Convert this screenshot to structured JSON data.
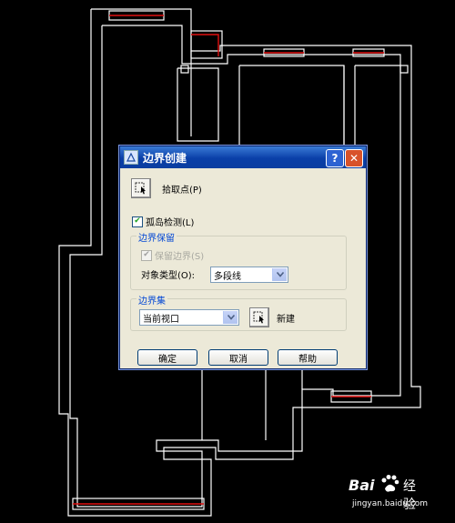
{
  "dialog": {
    "title": "边界创建",
    "help_button": "?",
    "close_button": "✕",
    "pick_points_label": "拾取点(P)",
    "island_detection_label": "孤岛检测(L)",
    "island_detection_checked": true,
    "boundary_retention": {
      "group_label": "边界保留",
      "retain_boundaries_label": "保留边界(S)",
      "retain_boundaries_checked": true,
      "retain_boundaries_enabled": false,
      "object_type_label": "对象类型(O):",
      "object_type_value": "多段线"
    },
    "boundary_set": {
      "group_label": "边界集",
      "set_value": "当前视口",
      "new_label": "新建"
    },
    "buttons": {
      "ok": "确定",
      "cancel": "取消",
      "help": "帮助"
    }
  },
  "watermark": {
    "brand": "Bai",
    "brand_suffix": "经验",
    "url": "jingyan.baidu.com"
  },
  "colors": {
    "wall": "#ffffff",
    "window": "#e01010",
    "title_bar": "#0a3fa8",
    "dialog_bg": "#ece9d8"
  }
}
